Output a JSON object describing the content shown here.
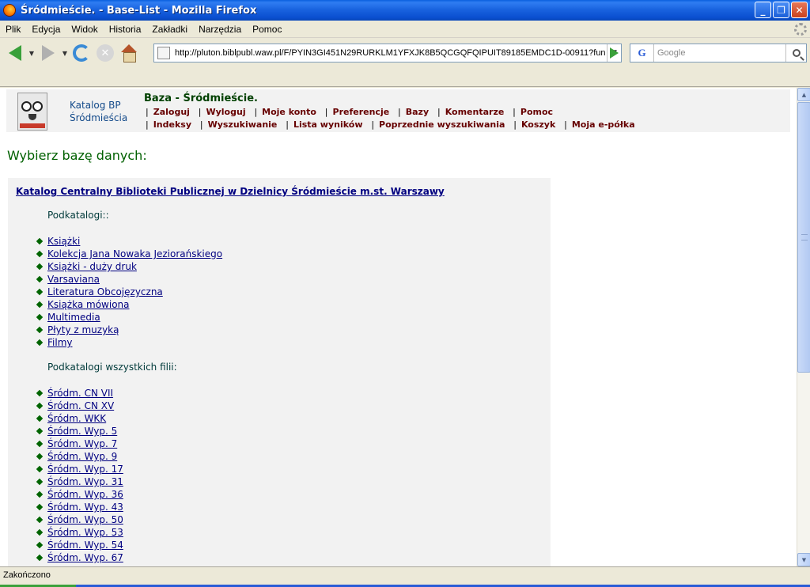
{
  "window": {
    "title": "Śródmieście. - Base-List - Mozilla Firefox",
    "buttons": {
      "minimize": "_",
      "maximize": "❐",
      "close": "✕"
    }
  },
  "menu": [
    "Plik",
    "Edycja",
    "Widok",
    "Historia",
    "Zakładki",
    "Narzędzia",
    "Pomoc"
  ],
  "toolbar": {
    "url": "http://pluton.biblpubl.waw.pl/F/PYIN3GI451N29RURKLM1YFXJK8B5QCGQFQIPUIT89185EMDC1D-00911?fun",
    "search_engine": "G",
    "search_placeholder": "Google",
    "icons": [
      "back-icon",
      "forward-icon",
      "reload-icon",
      "stop-icon",
      "home-icon",
      "go-icon",
      "search-icon"
    ]
  },
  "header": {
    "catalog_line1": "Katalog BP",
    "catalog_line2": "Śródmieścia",
    "base_title": "Baza - Śródmieście.",
    "nav_row1": [
      "Zaloguj",
      "Wyloguj",
      "Moje konto",
      "Preferencje",
      "Bazy",
      "Komentarze",
      "Pomoc"
    ],
    "nav_row2": [
      "Indeksy",
      "Wyszukiwanie",
      "Lista wyników",
      "Poprzednie wyszukiwania",
      "Koszyk",
      "Moja e-półka"
    ],
    "separator": "|"
  },
  "main": {
    "page_title": "Wybierz bazę danych:",
    "database_link": "Katalog Centralny Biblioteki Publicznej w Dzielnicy Śródmieście m.st. Warszawy",
    "subcatalogs_label": "Podkatalogi::",
    "subcatalogs": [
      "Książki",
      "Kolekcja Jana Nowaka Jeziorańskiego",
      "Książki - duży druk",
      "Varsaviana",
      "Literatura Obcojęzyczna",
      "Książka mówiona",
      "Multimedia",
      "Płyty z muzyką",
      "Filmy"
    ],
    "branches_label": "Podkatalogi wszystkich filii:",
    "branches": [
      "Śródm. CN VII",
      "Śródm. CN XV",
      "Śródm. WKK",
      "Śródm. Wyp. 5",
      "Śródm. Wyp. 7",
      "Śródm. Wyp. 9",
      "Śródm. Wyp. 17",
      "Śródm. Wyp. 31",
      "Śródm. Wyp. 36",
      "Śródm. Wyp. 43",
      "Śródm. Wyp. 50",
      "Śródm. Wyp. 53",
      "Śródm. Wyp. 54",
      "Śródm. Wyp. 67"
    ]
  },
  "status": {
    "text": "Zakończono"
  },
  "colors": {
    "title_bar": "#0a4fd0",
    "nav_link": "#660000",
    "page_title": "#006000",
    "link": "#000080",
    "bullet": "#006400"
  }
}
